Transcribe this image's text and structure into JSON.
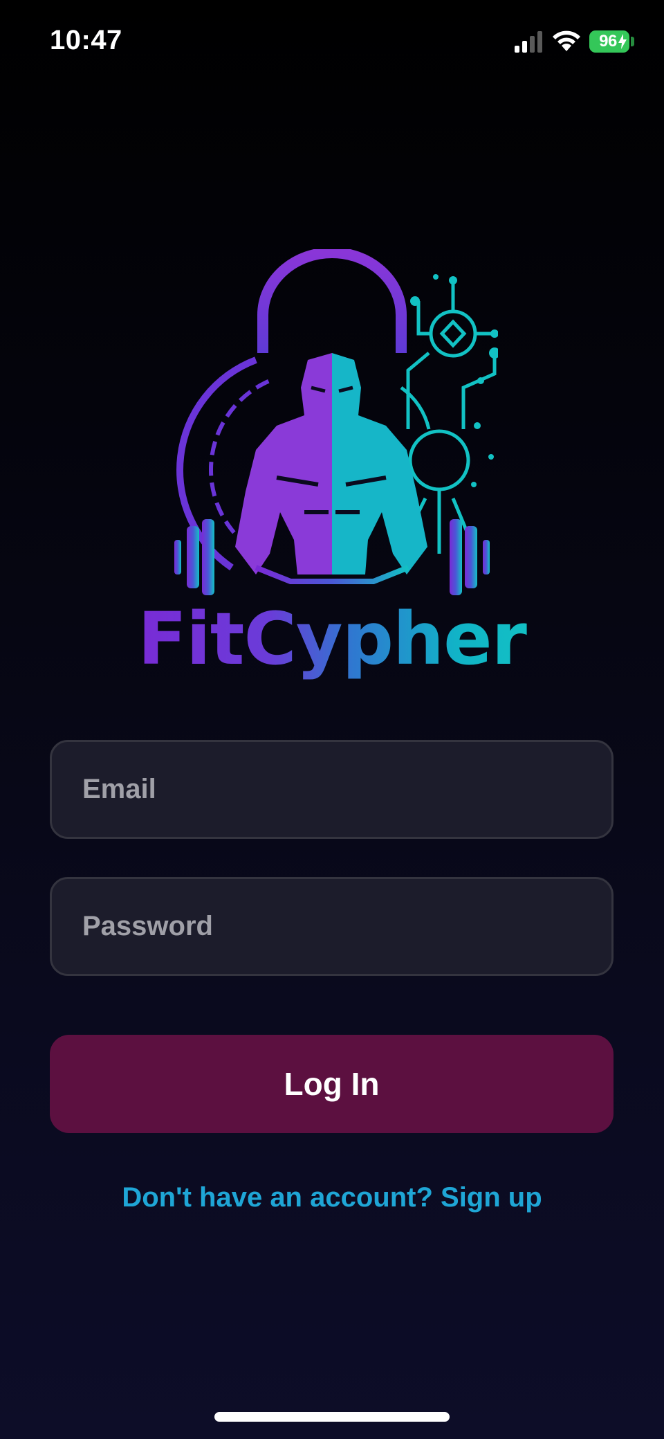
{
  "status_bar": {
    "time": "10:47",
    "battery_percent": "96",
    "icons": [
      "signal-icon",
      "wifi-icon",
      "battery-icon"
    ]
  },
  "logo": {
    "brand_name": "FitCypher",
    "colors": {
      "purple": "#7a2ad6",
      "cyan": "#12c2c4"
    }
  },
  "form": {
    "email_placeholder": "Email",
    "password_placeholder": "Password",
    "login_label": "Log In",
    "signup_text": "Don't have an account? Sign up"
  },
  "colors": {
    "login_button": "#5c1040",
    "link": "#1fa6d6",
    "field_bg": "#1c1c2b",
    "battery": "#34c759"
  }
}
